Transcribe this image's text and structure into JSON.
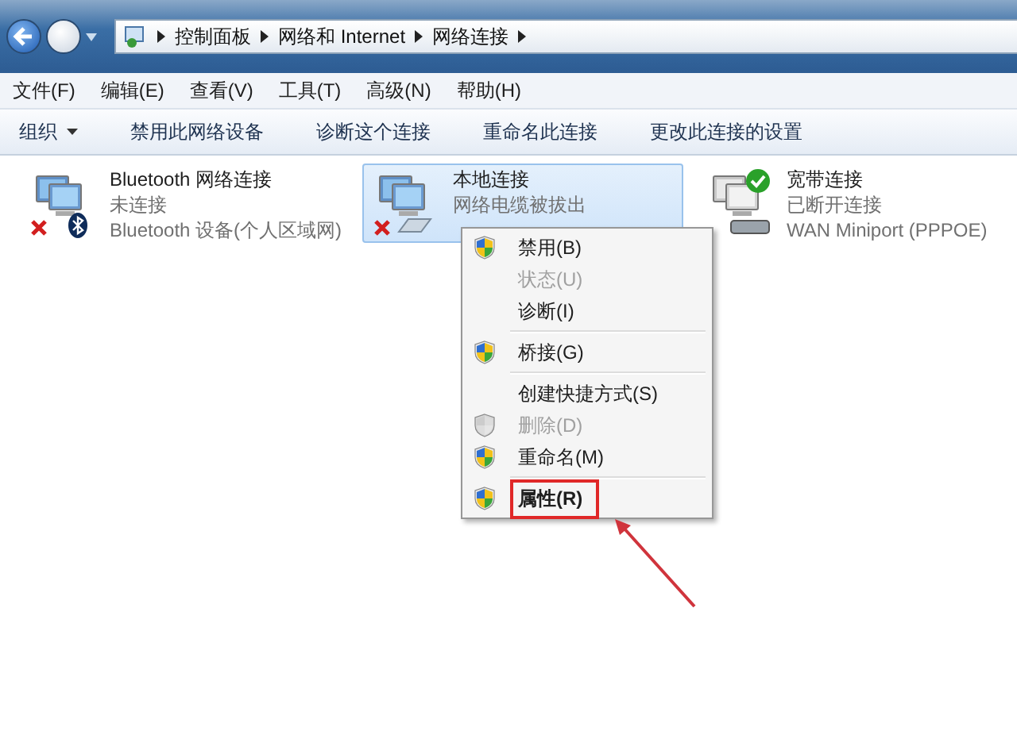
{
  "address": {
    "path": [
      "控制面板",
      "网络和 Internet",
      "网络连接"
    ]
  },
  "menu_bar": [
    "文件(F)",
    "编辑(E)",
    "查看(V)",
    "工具(T)",
    "高级(N)",
    "帮助(H)"
  ],
  "toolbar": [
    {
      "label": "组织",
      "kind": "dropdown"
    },
    {
      "label": "禁用此网络设备",
      "kind": "button"
    },
    {
      "label": "诊断这个连接",
      "kind": "button"
    },
    {
      "label": "重命名此连接",
      "kind": "button"
    },
    {
      "label": "更改此连接的设置",
      "kind": "button"
    }
  ],
  "connections": [
    {
      "name": "Bluetooth 网络连接",
      "status": "未连接",
      "device": "Bluetooth 设备(个人区域网)",
      "kind": "bluetooth",
      "selected": false,
      "error": true,
      "connected_default": false
    },
    {
      "name": "本地连接",
      "status": "网络电缆被拔出",
      "kind": "ethernet",
      "selected": true,
      "error": true,
      "connected_default": false
    },
    {
      "name": "宽带连接",
      "status": "已断开连接",
      "device": "WAN Miniport (PPPOE)",
      "kind": "modem",
      "selected": false,
      "error": false,
      "connected_default": true
    }
  ],
  "context_menu": [
    {
      "kind": "item",
      "label": "禁用(B)",
      "shield": true,
      "disabled": false,
      "bold": false,
      "highlighted": false
    },
    {
      "kind": "item",
      "label": "状态(U)",
      "shield": false,
      "disabled": true,
      "bold": false,
      "highlighted": false
    },
    {
      "kind": "item",
      "label": "诊断(I)",
      "shield": false,
      "disabled": false,
      "bold": false,
      "highlighted": false
    },
    {
      "kind": "separator"
    },
    {
      "kind": "item",
      "label": "桥接(G)",
      "shield": true,
      "disabled": false,
      "bold": false,
      "highlighted": false
    },
    {
      "kind": "separator"
    },
    {
      "kind": "item",
      "label": "创建快捷方式(S)",
      "shield": false,
      "disabled": false,
      "bold": false,
      "highlighted": false
    },
    {
      "kind": "item",
      "label": "删除(D)",
      "shield": true,
      "disabled": true,
      "bold": false,
      "highlighted": false
    },
    {
      "kind": "item",
      "label": "重命名(M)",
      "shield": true,
      "disabled": false,
      "bold": false,
      "highlighted": false
    },
    {
      "kind": "separator"
    },
    {
      "kind": "item",
      "label": "属性(R)",
      "shield": true,
      "disabled": false,
      "bold": true,
      "highlighted": true
    }
  ]
}
